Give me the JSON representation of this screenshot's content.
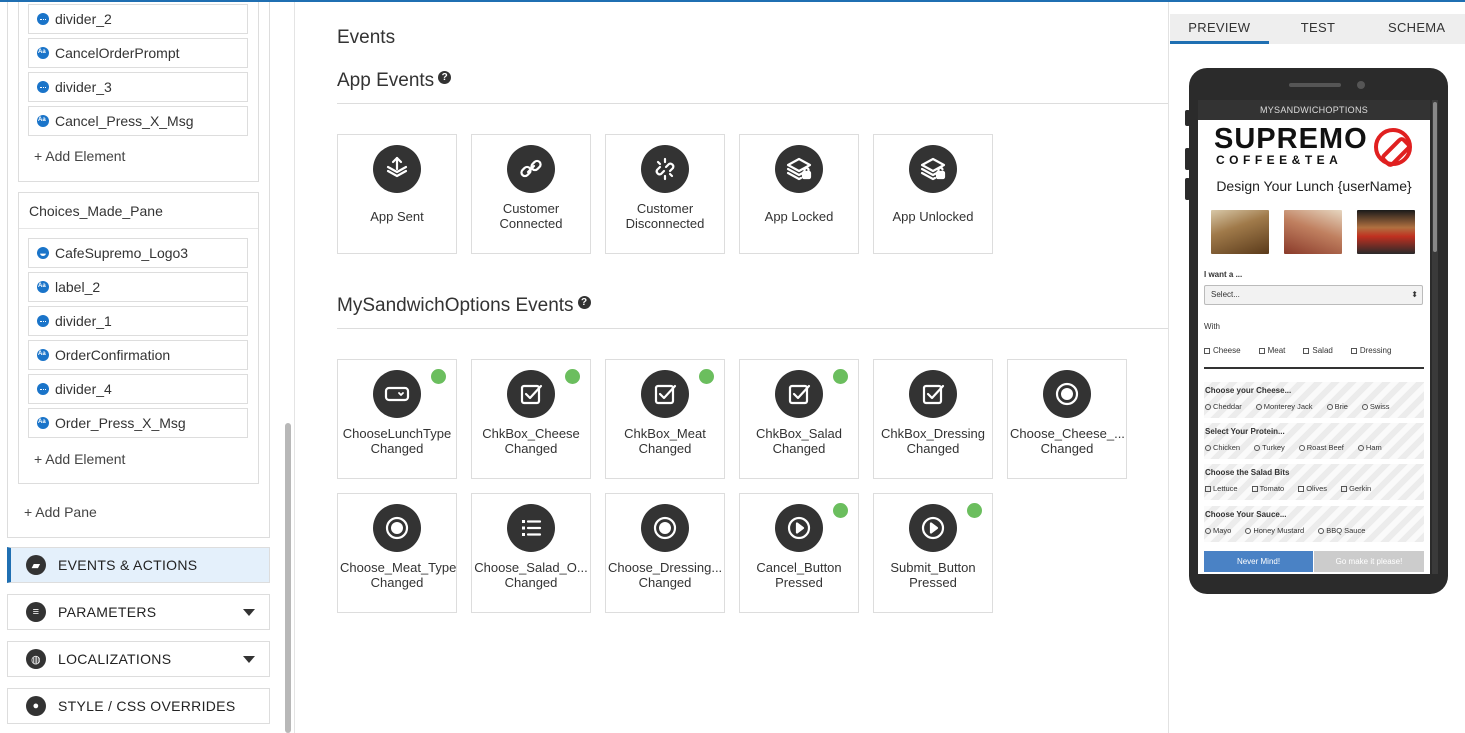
{
  "left_panel": {
    "pane1_elements": [
      {
        "name": "divider_2",
        "icon": "divider-icon"
      },
      {
        "name": "CancelOrderPrompt",
        "icon": "text-icon"
      },
      {
        "name": "divider_3",
        "icon": "divider-icon"
      },
      {
        "name": "Cancel_Press_X_Msg",
        "icon": "text-icon"
      }
    ],
    "add_element_label": "+ Add Element",
    "pane2_title": "Choices_Made_Pane",
    "pane2_elements": [
      {
        "name": "CafeSupremo_Logo3",
        "icon": "image-icon"
      },
      {
        "name": "label_2",
        "icon": "text-icon"
      },
      {
        "name": "divider_1",
        "icon": "divider-icon"
      },
      {
        "name": "OrderConfirmation",
        "icon": "text-icon"
      },
      {
        "name": "divider_4",
        "icon": "divider-icon"
      },
      {
        "name": "Order_Press_X_Msg",
        "icon": "text-icon"
      }
    ],
    "add_pane_label": "+ Add Pane",
    "sections": [
      {
        "label": "EVENTS & ACTIONS",
        "icon": "clapperboard-icon",
        "active": true
      },
      {
        "label": "PARAMETERS",
        "icon": "list-icon"
      },
      {
        "label": "LOCALIZATIONS",
        "icon": "globe-icon"
      },
      {
        "label": "STYLE / CSS OVERRIDES",
        "icon": "palette-icon"
      }
    ]
  },
  "main": {
    "title": "Events",
    "app_events_title": "App Events",
    "app_events": [
      {
        "label": "App Sent",
        "icon": "app-sent-icon"
      },
      {
        "label": "Customer\nConnected",
        "icon": "link-icon"
      },
      {
        "label": "Customer\nDisconnected",
        "icon": "unlink-icon"
      },
      {
        "label": "App Locked",
        "icon": "stack-lock-icon"
      },
      {
        "label": "App Unlocked",
        "icon": "stack-unlock-icon"
      }
    ],
    "app_section_title": "MySandwichOptions Events",
    "app_section_events": [
      {
        "label": "ChooseLunchType\nChanged",
        "icon": "dropdown-icon",
        "active": true
      },
      {
        "label": "ChkBox_Cheese\nChanged",
        "icon": "checkbox-icon",
        "active": true
      },
      {
        "label": "ChkBox_Meat\nChanged",
        "icon": "checkbox-icon",
        "active": true
      },
      {
        "label": "ChkBox_Salad\nChanged",
        "icon": "checkbox-icon",
        "active": true
      },
      {
        "label": "ChkBox_Dressing\nChanged",
        "icon": "checkbox-icon",
        "active": false
      },
      {
        "label": "Choose_Cheese_...\nChanged",
        "icon": "radio-icon",
        "active": false
      },
      {
        "label": "Choose_Meat_Type\nChanged",
        "icon": "radio-icon",
        "active": false
      },
      {
        "label": "Choose_Salad_O...\nChanged",
        "icon": "list-icon",
        "active": false
      },
      {
        "label": "Choose_Dressing...\nChanged",
        "icon": "radio-icon",
        "active": false
      },
      {
        "label": "Cancel_Button\nPressed",
        "icon": "play-icon",
        "active": true
      },
      {
        "label": "Submit_Button\nPressed",
        "icon": "play-icon",
        "active": true
      }
    ]
  },
  "right_panel": {
    "tabs": [
      {
        "label": "PREVIEW",
        "active": true
      },
      {
        "label": "TEST"
      },
      {
        "label": "SCHEMA"
      }
    ],
    "preview": {
      "screen_title": "MYSANDWICHOPTIONS",
      "logo_main": "SUPREMO",
      "logo_sub": "COFFEE&TEA",
      "heading": "Design Your Lunch {userName}",
      "want_label": "I want a ...",
      "select_placeholder": "Select...",
      "with_label": "With",
      "with_options": [
        "Cheese",
        "Meat",
        "Salad",
        "Dressing"
      ],
      "blocks": [
        {
          "title": "Choose your Cheese...",
          "options": [
            "Cheddar",
            "Monterey Jack",
            "Brie",
            "Swiss"
          ],
          "kind": "radio"
        },
        {
          "title": "Select Your Protein...",
          "options": [
            "Chicken",
            "Turkey",
            "Roast Beef",
            "Ham"
          ],
          "kind": "radio"
        },
        {
          "title": "Choose the Salad Bits",
          "options": [
            "Lettuce",
            "Tomato",
            "Olives",
            "Gerkin"
          ],
          "kind": "check"
        },
        {
          "title": "Choose Your Sauce...",
          "options": [
            "Mayo",
            "Honey Mustard",
            "BBQ Sauce"
          ],
          "kind": "radio"
        }
      ],
      "never_mind": "Never Mind!",
      "go_make": "Go make it please!"
    }
  }
}
